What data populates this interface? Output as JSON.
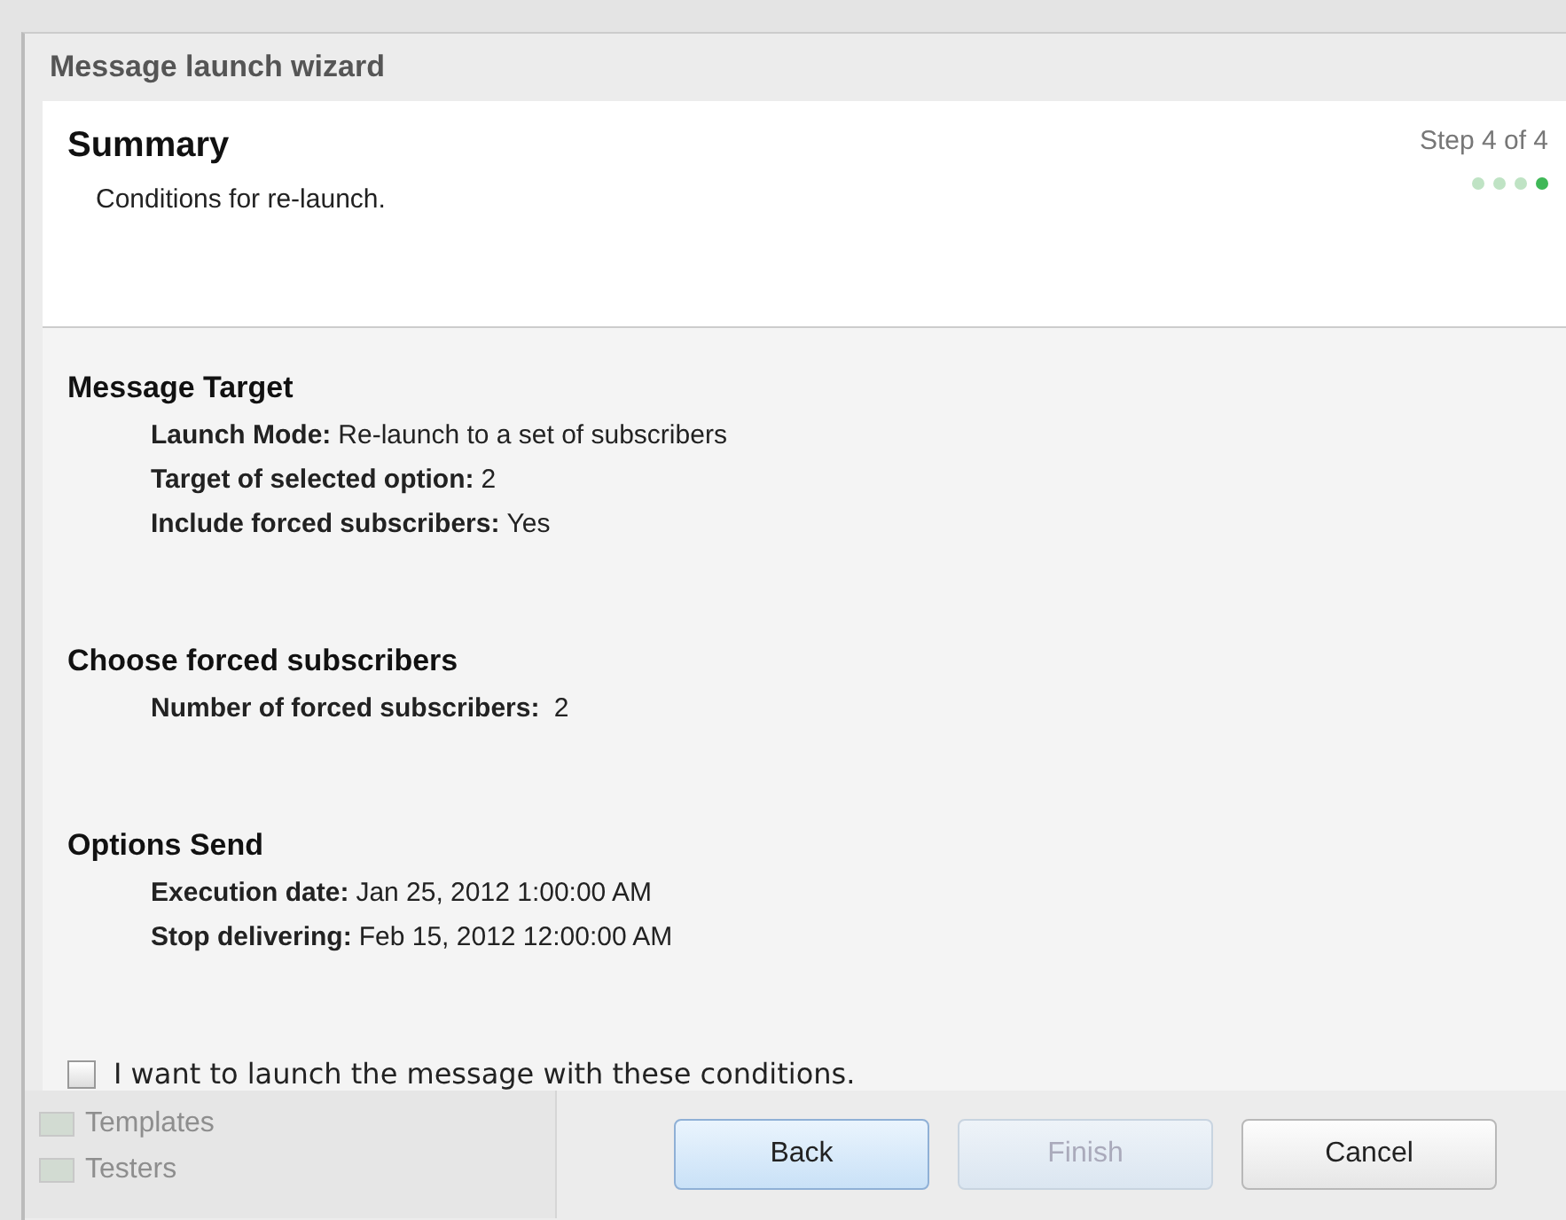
{
  "window": {
    "title": "Message launch wizard"
  },
  "header": {
    "title": "Summary",
    "subtitle": "Conditions for re-launch.",
    "step": "Step 4 of 4",
    "steps": [
      {
        "selected": false
      },
      {
        "selected": false
      },
      {
        "selected": false
      },
      {
        "selected": true
      }
    ]
  },
  "sections": [
    {
      "title": "Message Target",
      "rows": [
        {
          "label": "Launch Mode:",
          "value": "Re-launch to a set  of subscribers"
        },
        {
          "label": "Target of selected option:",
          "value": "2"
        },
        {
          "label": "Include forced subscribers:",
          "value": "Yes"
        }
      ]
    },
    {
      "title": "Choose forced subscribers",
      "rows": [
        {
          "label": "Number of forced subscribers:",
          "value": " 2"
        }
      ]
    },
    {
      "title": "Options Send",
      "rows": [
        {
          "label": "Execution date:",
          "value": "Jan 25, 2012 1:00:00 AM"
        },
        {
          "label": "Stop delivering:",
          "value": "Feb 15, 2012 12:00:00 AM"
        }
      ]
    }
  ],
  "confirm": {
    "label": "I want to launch the message with these conditions.",
    "checked": false
  },
  "background_sidebar": [
    {
      "label": "Templates"
    },
    {
      "label": "Testers"
    }
  ],
  "buttons": [
    {
      "label": "Back",
      "disabled": false,
      "selected": true
    },
    {
      "label": "Finish",
      "disabled": true,
      "selected": false
    },
    {
      "label": "Cancel",
      "disabled": false,
      "selected": false
    }
  ]
}
